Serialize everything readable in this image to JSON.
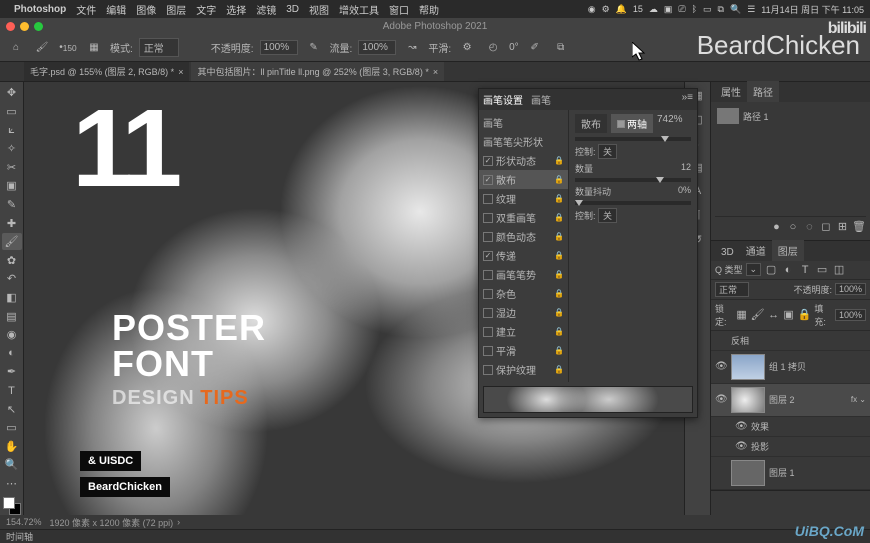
{
  "menubar": {
    "app": "Photoshop",
    "items": [
      "文件",
      "编辑",
      "图像",
      "图层",
      "文字",
      "选择",
      "滤镜",
      "3D",
      "视图",
      "增效工具",
      "窗口",
      "帮助"
    ],
    "right_status": "15",
    "datetime": "11月14日 周日 下午 11:05"
  },
  "titlebar": {
    "title": "Adobe Photoshop 2021"
  },
  "options": {
    "mode_label": "模式:",
    "mode_value": "正常",
    "opacity_label": "不透明度:",
    "opacity_value": "100%",
    "flow_label": "流量:",
    "flow_value": "100%",
    "smoothing_label": "平滑:",
    "angle_value": "0°",
    "brush_size": "150",
    "brand": "BeardChicken"
  },
  "tabs": [
    {
      "label": "毛字.psd @ 155% (图层 2, RGB/8) *",
      "active": true
    },
    {
      "label": "其中包括图片：ll pinTitle ll.png @ 252% (图层 3, RGB/8) *",
      "active": false
    }
  ],
  "canvas": {
    "big_number": "11",
    "poster_l1": "POSTER",
    "poster_l2": "FONT",
    "poster_l3a": "DESIGN",
    "poster_l3b": "TIPS",
    "badge1": "& UISDC",
    "badge2": "BeardChicken"
  },
  "brush_panel": {
    "tabs": [
      "画笔设置",
      "画笔"
    ],
    "left_items": [
      {
        "label": "画笔",
        "checked": null
      },
      {
        "label": "画笔笔尖形状",
        "checked": null
      },
      {
        "label": "形状动态",
        "checked": true
      },
      {
        "label": "散布",
        "checked": true,
        "selected": true
      },
      {
        "label": "纹理",
        "checked": false
      },
      {
        "label": "双重画笔",
        "checked": false
      },
      {
        "label": "颜色动态",
        "checked": false
      },
      {
        "label": "传递",
        "checked": true
      },
      {
        "label": "画笔笔势",
        "checked": false
      },
      {
        "label": "杂色",
        "checked": false
      },
      {
        "label": "湿边",
        "checked": false
      },
      {
        "label": "建立",
        "checked": false
      },
      {
        "label": "平滑",
        "checked": false
      },
      {
        "label": "保护纹理",
        "checked": false
      }
    ],
    "subtabs": [
      "散布",
      "两轴"
    ],
    "scatter_value": "742%",
    "control_label": "控制:",
    "control_value": "关",
    "count_label": "数量",
    "count_value": "12",
    "jitter_label": "数量抖动",
    "jitter_value": "0%",
    "control2_value": "关"
  },
  "panels": {
    "prop_tabs": [
      "属性",
      "路径"
    ],
    "path_name": "路径 1",
    "layer_tabs": [
      "3D",
      "通道",
      "图层"
    ],
    "filter_label": "Q 类型",
    "blend_mode": "正常",
    "opacity_label": "不透明度:",
    "opacity_value": "100%",
    "lock_label": "锁定:",
    "fill_label": "填充:",
    "fill_value": "100%",
    "layers": [
      {
        "name": "反相",
        "visible": false,
        "type": "adj"
      },
      {
        "name": "组 1 拷贝",
        "visible": true,
        "type": "group",
        "thumb": "beard"
      },
      {
        "name": "图层 2",
        "visible": true,
        "type": "normal",
        "thumb": "clouds",
        "selected": true,
        "fx": true
      },
      {
        "name": "效果",
        "visible": true,
        "type": "sub"
      },
      {
        "name": "投影",
        "visible": true,
        "type": "sub"
      },
      {
        "name": "图层 1",
        "visible": false,
        "type": "normal",
        "thumb": "gray"
      }
    ]
  },
  "statusbar": {
    "zoom": "154.72%",
    "doc_info": "1920 像素 x 1200 像素 (72 ppi)"
  },
  "timeline": {
    "label": "时间轴"
  },
  "watermark": "UiBQ.CoM",
  "bilibili": "bilibili"
}
